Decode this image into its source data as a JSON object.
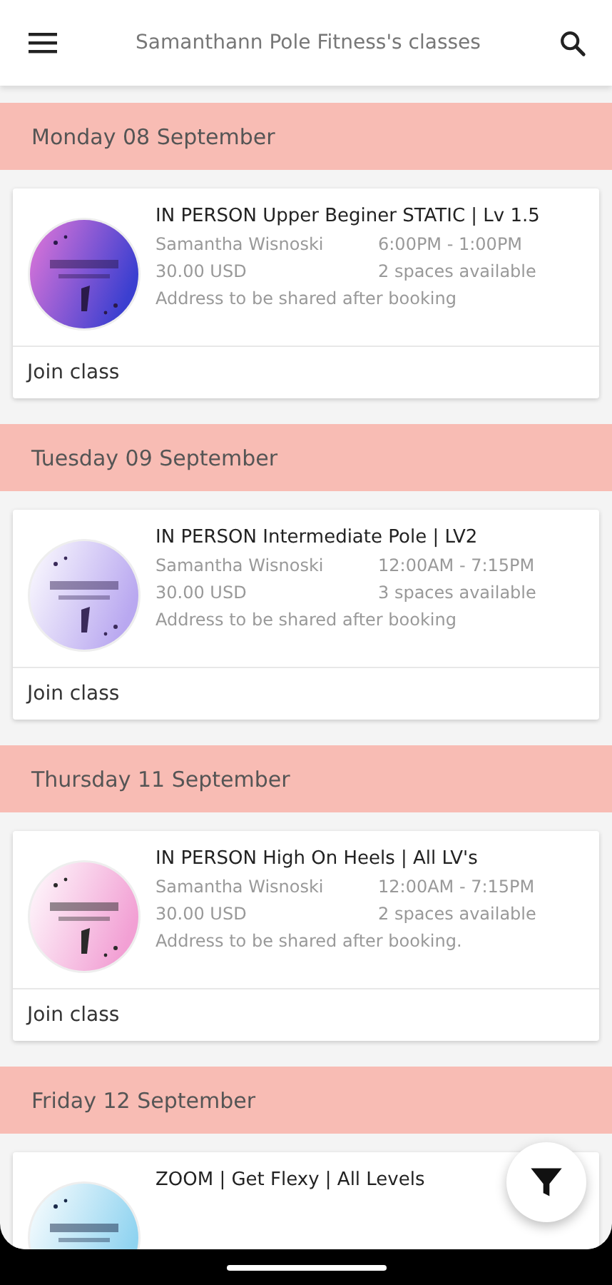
{
  "app_bar": {
    "title": "Samanthann Pole Fitness's classes"
  },
  "days": [
    {
      "date": "Monday 08 September",
      "classes": [
        {
          "title": "IN PERSON Upper Beginer STATIC | Lv 1.5",
          "instructor": "Samantha Wisnoski",
          "time": "6:00PM - 1:00PM",
          "price": "30.00 USD",
          "spaces": "2 spaces available",
          "address": "Address to be shared after booking",
          "action": "Join class"
        }
      ]
    },
    {
      "date": "Tuesday 09 September",
      "classes": [
        {
          "title": "IN PERSON Intermediate Pole | LV2",
          "instructor": "Samantha Wisnoski",
          "time": "12:00AM - 7:15PM",
          "price": "30.00 USD",
          "spaces": "3 spaces available",
          "address": "Address to be shared after booking",
          "action": "Join class"
        }
      ]
    },
    {
      "date": "Thursday 11 September",
      "classes": [
        {
          "title": "IN PERSON High On Heels | All LV's",
          "instructor": "Samantha Wisnoski",
          "time": "12:00AM - 7:15PM",
          "price": "30.00 USD",
          "spaces": "2 spaces available",
          "address": "Address to be shared after booking.",
          "action": "Join class"
        }
      ]
    },
    {
      "date": "Friday 12 September",
      "classes": [
        {
          "title": "ZOOM | Get Flexy | All Levels"
        }
      ]
    }
  ]
}
